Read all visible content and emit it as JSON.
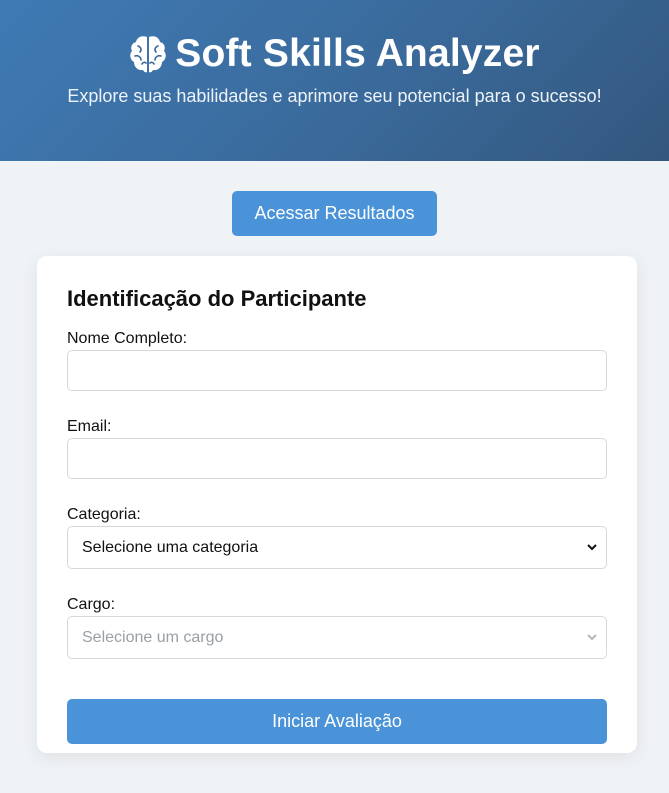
{
  "header": {
    "title": "Soft Skills Analyzer",
    "subtitle": "Explore suas habilidades e aprimore seu potencial para o sucesso!",
    "icon": "brain-icon"
  },
  "results_button": {
    "label": "Acessar Resultados"
  },
  "form": {
    "heading": "Identificação do Participante",
    "name": {
      "label": "Nome Completo:",
      "value": ""
    },
    "email": {
      "label": "Email:",
      "value": ""
    },
    "category": {
      "label": "Categoria:",
      "selected": "Selecione uma categoria"
    },
    "role": {
      "label": "Cargo:",
      "selected": "Selecione um cargo"
    },
    "submit_label": "Iniciar Avaliação"
  },
  "colors": {
    "header_gradient": [
      "#3f7ab4",
      "#33577e"
    ],
    "primary_button": "#4a93d9",
    "background": "#f0f3f6"
  }
}
